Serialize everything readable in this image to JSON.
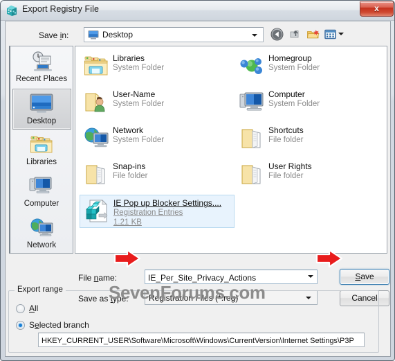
{
  "window": {
    "title": "Export Registry File",
    "title_icon": "registry-editor-icon",
    "close_label": "x"
  },
  "toolbar": {
    "save_in_label": "Save in:",
    "save_in_value": "Desktop",
    "save_in_icon": "desktop-monitor-icon",
    "buttons": [
      {
        "name": "back-button",
        "icon": "back-arrow-icon"
      },
      {
        "name": "up-one-level-button",
        "icon": "up-folder-icon"
      },
      {
        "name": "new-folder-button",
        "icon": "new-folder-icon"
      },
      {
        "name": "views-button",
        "icon": "views-grid-icon"
      }
    ]
  },
  "places_bar": {
    "items": [
      {
        "label": "Recent Places",
        "icon": "recent-places-icon",
        "selected": false
      },
      {
        "label": "Desktop",
        "icon": "desktop-monitor-icon",
        "selected": true
      },
      {
        "label": "Libraries",
        "icon": "libraries-folder-icon",
        "selected": false
      },
      {
        "label": "Computer",
        "icon": "computer-icon",
        "selected": false
      },
      {
        "label": "Network",
        "icon": "network-globe-icon",
        "selected": false
      }
    ]
  },
  "file_list": {
    "items": [
      {
        "name": "Libraries",
        "sub": "System Folder",
        "sub2": "",
        "icon": "libraries-folder-icon",
        "selected": false
      },
      {
        "name": "Homegroup",
        "sub": "System Folder",
        "sub2": "",
        "icon": "homegroup-icon",
        "selected": false
      },
      {
        "name": "User-Name",
        "sub": "System Folder",
        "sub2": "",
        "icon": "user-folder-icon",
        "selected": false
      },
      {
        "name": "Computer",
        "sub": "System Folder",
        "sub2": "",
        "icon": "computer-icon",
        "selected": false
      },
      {
        "name": "Network",
        "sub": "System Folder",
        "sub2": "",
        "icon": "network-globe-icon",
        "selected": false
      },
      {
        "name": "Shortcuts",
        "sub": "File folder",
        "sub2": "",
        "icon": "open-folder-icon",
        "selected": false
      },
      {
        "name": "Snap-ins",
        "sub": "File folder",
        "sub2": "",
        "icon": "open-folder-icon",
        "selected": false
      },
      {
        "name": "User Rights",
        "sub": "File folder",
        "sub2": "",
        "icon": "open-folder-icon",
        "selected": false
      },
      {
        "name": "IE Pop up Blocker Settings....",
        "sub": "Registration Entries",
        "sub2": "1.21 KB",
        "icon": "reg-file-icon",
        "selected": true
      }
    ]
  },
  "form": {
    "file_name_label": "File name:",
    "file_name_value": "IE_Per_Site_Privacy_Actions",
    "save_as_type_label": "Save as type:",
    "save_as_type_value": "Registration Files (*.reg)",
    "save_button": "Save",
    "cancel_button": "Cancel"
  },
  "export_range": {
    "group_title": "Export range",
    "option_all": "All",
    "option_selected_branch": "Selected branch",
    "selected_option": "Selected branch",
    "branch_path": "HKEY_CURRENT_USER\\Software\\Microsoft\\Windows\\CurrentVersion\\Internet Settings\\P3P"
  },
  "watermark": {
    "text": "SevenForums.com"
  },
  "annotations": {
    "arrow_file_name": "red-right-arrow",
    "arrow_save_button": "red-right-arrow"
  },
  "colors": {
    "accent": "#3c7fb1",
    "selection_bg": "#e8f3fd",
    "close_red": "#c4301c",
    "annotation_red": "#e81c1c",
    "watermark_gray": "#8c8c8c"
  }
}
